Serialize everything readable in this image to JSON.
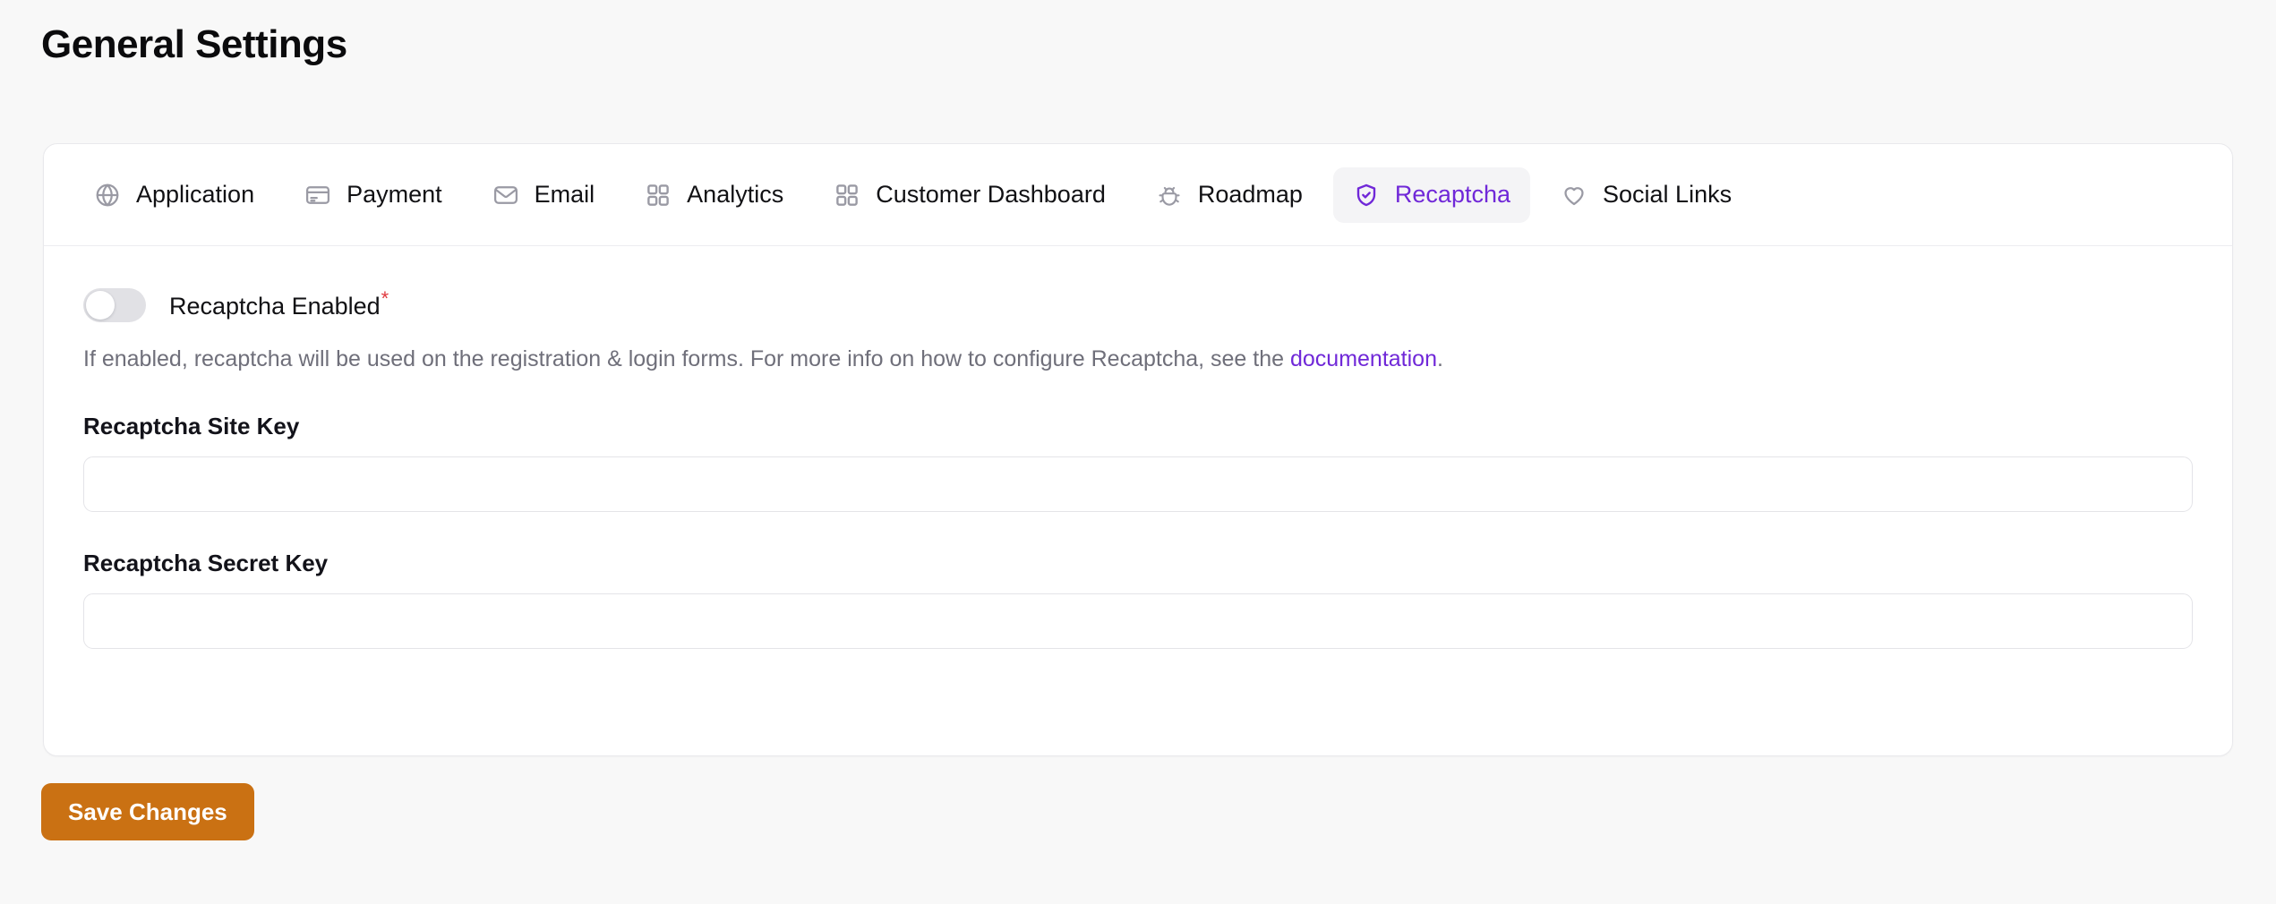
{
  "page": {
    "title": "General Settings"
  },
  "tabs": [
    {
      "id": "application",
      "label": "Application",
      "icon": "globe-icon",
      "active": false
    },
    {
      "id": "payment",
      "label": "Payment",
      "icon": "credit-card-icon",
      "active": false
    },
    {
      "id": "email",
      "label": "Email",
      "icon": "envelope-icon",
      "active": false
    },
    {
      "id": "analytics",
      "label": "Analytics",
      "icon": "grid-icon",
      "active": false
    },
    {
      "id": "customer-dashboard",
      "label": "Customer Dashboard",
      "icon": "grid-icon",
      "active": false
    },
    {
      "id": "roadmap",
      "label": "Roadmap",
      "icon": "bug-icon",
      "active": false
    },
    {
      "id": "recaptcha",
      "label": "Recaptcha",
      "icon": "shield-check-icon",
      "active": true
    },
    {
      "id": "social-links",
      "label": "Social Links",
      "icon": "heart-icon",
      "active": false
    }
  ],
  "form": {
    "toggle": {
      "label": "Recaptcha Enabled",
      "required_marker": "*",
      "checked": false
    },
    "help": {
      "before_link": "If enabled, recaptcha will be used on the registration & login forms. For more info on how to configure Recaptcha, see the ",
      "link_text": "documentation",
      "after_link": "."
    },
    "fields": [
      {
        "id": "site-key",
        "label": "Recaptcha Site Key",
        "value": "",
        "placeholder": ""
      },
      {
        "id": "secret-key",
        "label": "Recaptcha Secret Key",
        "value": "",
        "placeholder": ""
      }
    ]
  },
  "actions": {
    "save_label": "Save Changes"
  },
  "colors": {
    "accent_purple": "#7028d8",
    "save_orange": "#ca7113",
    "required_red": "#e0393e",
    "page_bg": "#f8f8f8",
    "card_bg": "#ffffff",
    "active_tab_bg": "#f4f4f6",
    "muted_text": "#6f6f7a",
    "icon_gray": "#9a9aa4"
  }
}
